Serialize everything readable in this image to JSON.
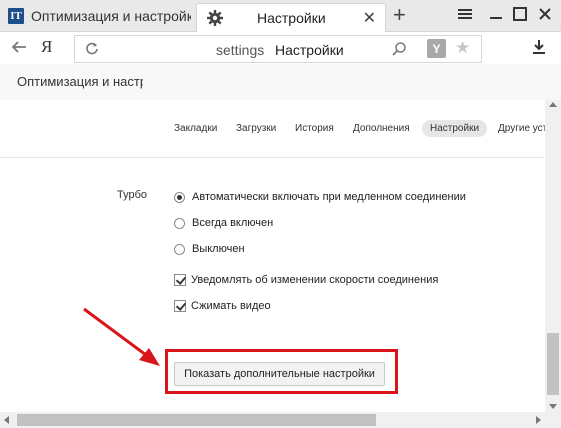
{
  "browser": {
    "inactive_tab": {
      "favicon_text": "IT",
      "title": "Оптимизация и настройка"
    },
    "active_tab": {
      "title": "Настройки",
      "icon": "gear-icon"
    },
    "new_tab_icon": "plus-icon",
    "window_controls": [
      "menu-icon",
      "minimize-icon",
      "maximize-icon",
      "close-icon"
    ]
  },
  "addressbar": {
    "logo": "Я",
    "url_scheme": "settings",
    "url_title": "Настройки",
    "icons": [
      "back-icon",
      "reload-icon",
      "search-icon",
      "protect-icon",
      "star-icon",
      "download-icon"
    ]
  },
  "page_tab": {
    "title": "Оптимизация и настр"
  },
  "settings_nav": {
    "items": [
      "Закладки",
      "Загрузки",
      "История",
      "Дополнения",
      "Настройки",
      "Другие устройства"
    ],
    "active": "Настройки"
  },
  "turbo": {
    "label": "Турбо",
    "radios": [
      {
        "label": "Автоматически включать при медленном соединении",
        "checked": true
      },
      {
        "label": "Всегда включен",
        "checked": false
      },
      {
        "label": "Выключен",
        "checked": false
      }
    ],
    "checkboxes": [
      {
        "label": "Уведомлять об изменении скорости соединения",
        "checked": true
      },
      {
        "label": "Сжимать видео",
        "checked": true
      }
    ]
  },
  "more_button": {
    "label": "Показать дополнительные настройки"
  },
  "annotation": {
    "highlight_color": "#d9151b",
    "arrow_color": "#d9151b"
  }
}
